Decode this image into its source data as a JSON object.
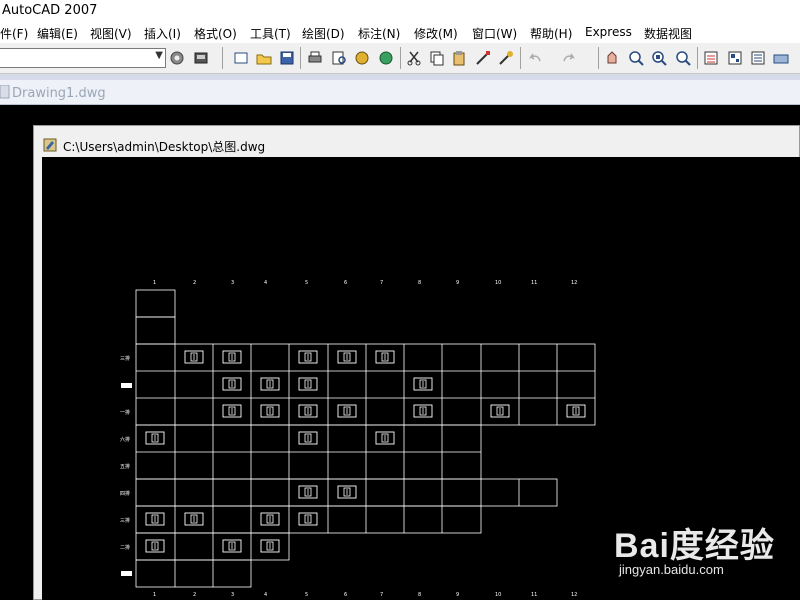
{
  "app": {
    "title": "AutoCAD 2007"
  },
  "menu": [
    "件(F)",
    "编辑(E)",
    "视图(V)",
    "插入(I)",
    "格式(O)",
    "工具(T)",
    "绘图(D)",
    "标注(N)",
    "修改(M)",
    "窗口(W)",
    "帮助(H)",
    "Express",
    "数据视图"
  ],
  "toolbar": {
    "layer_combo_value": ""
  },
  "tabs": {
    "background_doc": "Drawing1.dwg"
  },
  "window": {
    "title": "C:\\Users\\admin\\Desktop\\总图.dwg"
  },
  "drawing": {
    "column_numbers": [
      "1",
      "2",
      "3",
      "4",
      "5",
      "6",
      "7",
      "8",
      "9",
      "10",
      "11",
      "12"
    ],
    "row_labels": [
      "三排",
      "",
      "一排",
      "六排",
      "五排",
      "四排",
      "三排",
      "二排",
      ""
    ]
  },
  "watermark": {
    "brand": "Bai度经验",
    "url": "jingyan.baidu.com"
  },
  "colors": {
    "canvas": "#000000",
    "line": "#ffffff",
    "chrome": "#f0f0f0"
  }
}
